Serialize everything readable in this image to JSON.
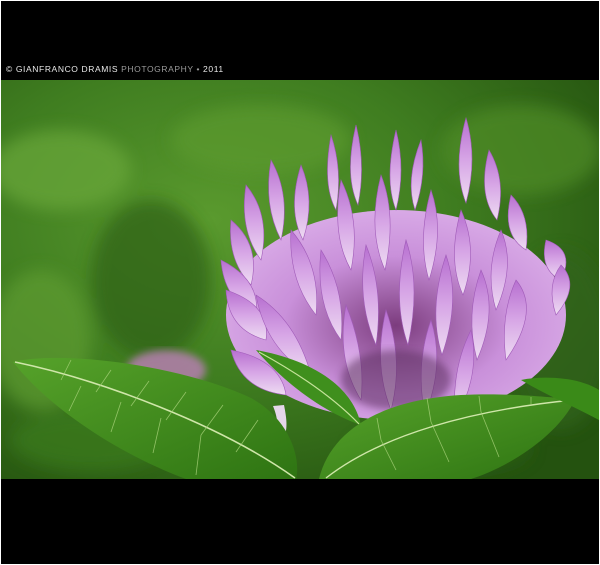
{
  "caption": {
    "copyright_symbol": "©",
    "photographer": "GIANFRANCO DRAMIS",
    "label": "PHOTOGRAPHY",
    "separator": "•",
    "year": "2011"
  },
  "photo": {
    "subject": "red-clover-flower",
    "colors": {
      "background_green": "#3f7a1f",
      "petal_pink": "#c98fd8",
      "petal_light": "#e9c8ef",
      "leaf_green": "#3c8a1c",
      "frame": "#000000"
    }
  }
}
